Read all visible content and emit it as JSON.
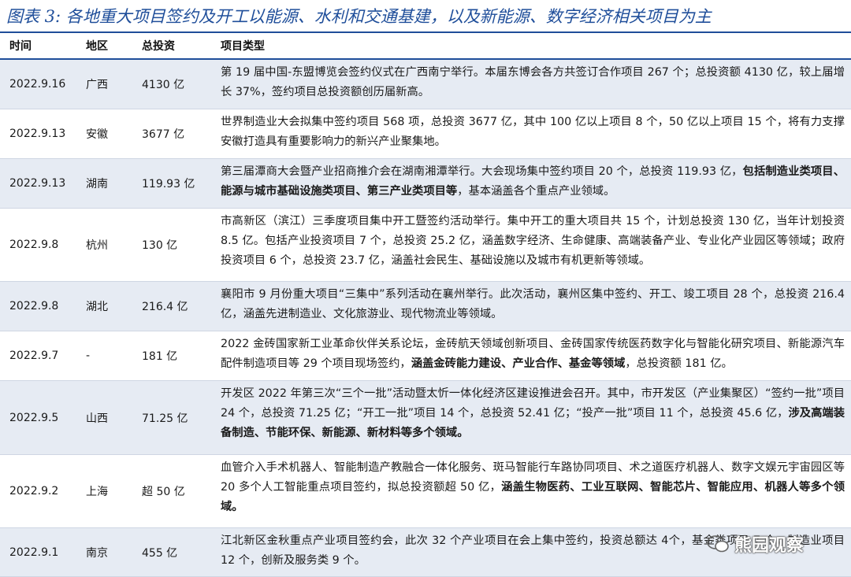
{
  "title": "图表 3:  各地重大项目签约及开工以能源、水利和交通基建，以及新能源、数字经济相关项目为主",
  "header": {
    "date": "时间",
    "region": "地区",
    "invest": "总投资",
    "type": "项目类型"
  },
  "rows": [
    {
      "date": "2022.9.16",
      "region": "广西",
      "invest": "4130 亿",
      "parts": [
        {
          "t": "第 19 届中国-东盟博览会签约仪式在广西南宁举行。本届东博会各方共签订合作项目 267 个；总投资额 4130 亿，较上届增长 37%，签约项目总投资额创历届新高。"
        }
      ]
    },
    {
      "date": "2022.9.13",
      "region": "安徽",
      "invest": "3677 亿",
      "parts": [
        {
          "t": "世界制造业大会拟集中签约项目 568 项，总投资 3677 亿，其中 100 亿以上项目 8 个，50 亿以上项目 15 个，将有力支撑安徽打造具有重要影响力的新兴产业聚集地。"
        }
      ]
    },
    {
      "date": "2022.9.13",
      "region": "湖南",
      "invest": "119.93 亿",
      "parts": [
        {
          "t": "第三届潭商大会暨产业招商推介会在湖南湘潭举行。大会现场集中签约项目 20 个，总投资 119.93 亿，"
        },
        {
          "t": "包括制造业类项目、能源与城市基础设施类项目、第三产业类项目等",
          "b": true
        },
        {
          "t": "，基本涵盖各个重点产业领域。"
        }
      ]
    },
    {
      "date": "2022.9.8",
      "region": "杭州",
      "invest": "130 亿",
      "parts": [
        {
          "t": "市高新区（滨江）三季度项目集中开工暨签约活动举行。集中开工的重大项目共 15 个，计划总投资 130 亿，当年计划投资 8.5 亿。包括产业投资项目 7 个，总投资 25.2 亿，涵盖数字经济、生命健康、高端装备产业、专业化产业园区等领域；政府投资项目 6 个，总投资 23.7 亿，涵盖社会民生、基础设施以及城市有机更新等领域。"
        }
      ]
    },
    {
      "date": "2022.9.8",
      "region": "湖北",
      "invest": "216.4 亿",
      "parts": [
        {
          "t": "襄阳市 9 月份重大项目“三集中”系列活动在襄州举行。此次活动，襄州区集中签约、开工、竣工项目 28 个，总投资 216.4 亿，涵盖先进制造业、文化旅游业、现代物流业等领域。"
        }
      ]
    },
    {
      "date": "2022.9.7",
      "region": "-",
      "invest": "181 亿",
      "parts": [
        {
          "t": "2022 金砖国家新工业革命伙伴关系论坛，金砖航天领域创新项目、金砖国家传统医药数字化与智能化研究项目、新能源汽车配件制造项目等 29 个项目现场签约，"
        },
        {
          "t": "涵盖金砖能力建设、产业合作、基金等领域",
          "b": true
        },
        {
          "t": "，总投资额 181 亿。"
        }
      ]
    },
    {
      "date": "2022.9.5",
      "region": "山西",
      "invest": "71.25 亿",
      "parts": [
        {
          "t": "开发区 2022 年第三次“三个一批”活动暨太忻一体化经济区建设推进会召开。其中，市开发区（产业集聚区）“签约一批”项目 24 个，总投资 71.25 亿；“开工一批”项目 14 个，总投资 52.41 亿；“投产一批”项目 11 个，总投资 45.6 亿，"
        },
        {
          "t": "涉及高端装备制造、节能环保、新能源、新材料等多个领域。",
          "b": true
        }
      ]
    },
    {
      "date": "2022.9.2",
      "region": "上海",
      "invest": "超 50 亿",
      "parts": [
        {
          "t": "血管介入手术机器人、智能制造产教融合一体化服务、斑马智能行车路协同项目、术之道医疗机器人、数字文娱元宇宙园区等 20 多个人工智能重点项目签约，拟总投资额超 50 亿，"
        },
        {
          "t": "涵盖生物医药、工业互联网、智能芯片、智能应用、机器人等多个领域。",
          "b": true
        }
      ]
    },
    {
      "date": "2022.9.1",
      "region": "南京",
      "invest": "455 亿",
      "parts": [
        {
          "t": "江北新区金秋重点产业项目签约会，此次 32 个产业项目在会上集中签约，投资总额达 4"
        },
        {
          "t": "个，基金类项目 7 个，制造业项目 12 个，创新及服务类 9 个。"
        }
      ]
    }
  ],
  "watermark": {
    "text": "熊园观察",
    "icon": "wechat-icon"
  }
}
